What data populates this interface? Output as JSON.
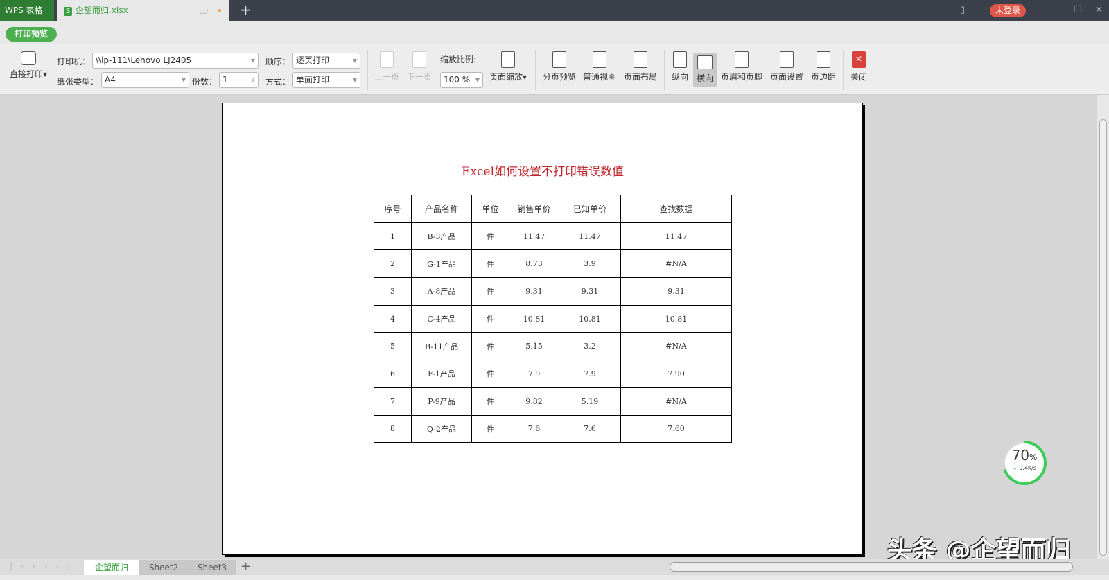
{
  "titlebar": {
    "app": "WPS 表格",
    "doc": "企望而归.xlsx",
    "doc_icon": "S",
    "login": "未登录"
  },
  "ribbon": {
    "print_preview": "打印预览"
  },
  "toolbar": {
    "direct_print": "直接打印",
    "printer_label": "打印机：",
    "printer": "\\\\ip-111\\Lenovo LJ2405",
    "paper_label": "纸张类型：",
    "paper": "A4",
    "copies_label": "份数：",
    "copies": "1",
    "order_label": "顺序：",
    "order": "逐页打印",
    "mode_label": "方式：",
    "mode": "单面打印",
    "prev": "上一页",
    "next": "下一页",
    "zoom_label": "缩放比例:",
    "zoom": "100 %",
    "page_zoom": "页面缩放",
    "buttons": [
      "分页预览",
      "普通视图",
      "页面布局",
      "纵向",
      "横向",
      "页眉和页脚",
      "页面设置",
      "页边距",
      "关闭"
    ]
  },
  "page": {
    "title": "Excel如何设置不打印错误数值",
    "headers": [
      "序号",
      "产品名称",
      "单位",
      "销售单价",
      "已知单价",
      "查找数据"
    ],
    "rows": [
      [
        "1",
        "B-3产品",
        "件",
        "11.47",
        "11.47",
        "11.47"
      ],
      [
        "2",
        "G-1产品",
        "件",
        "8.73",
        "3.9",
        "#N/A"
      ],
      [
        "3",
        "A-8产品",
        "件",
        "9.31",
        "9.31",
        "9.31"
      ],
      [
        "4",
        "C-4产品",
        "件",
        "10.81",
        "10.81",
        "10.81"
      ],
      [
        "5",
        "B-11产品",
        "件",
        "5.15",
        "3.2",
        "#N/A"
      ],
      [
        "6",
        "F-1产品",
        "件",
        "7.9",
        "7.9",
        "7.90"
      ],
      [
        "7",
        "P-9产品",
        "件",
        "9.82",
        "5.19",
        "#N/A"
      ],
      [
        "8",
        "Q-2产品",
        "件",
        "7.6",
        "7.6",
        "7.60"
      ]
    ]
  },
  "sheets": [
    "企望而归",
    "Sheet2",
    "Sheet3"
  ],
  "gauge": {
    "percent": "70",
    "unit": "%",
    "speed": "0.4K/s",
    "fraction": 0.7
  },
  "watermark": "头条 @企望而归"
}
